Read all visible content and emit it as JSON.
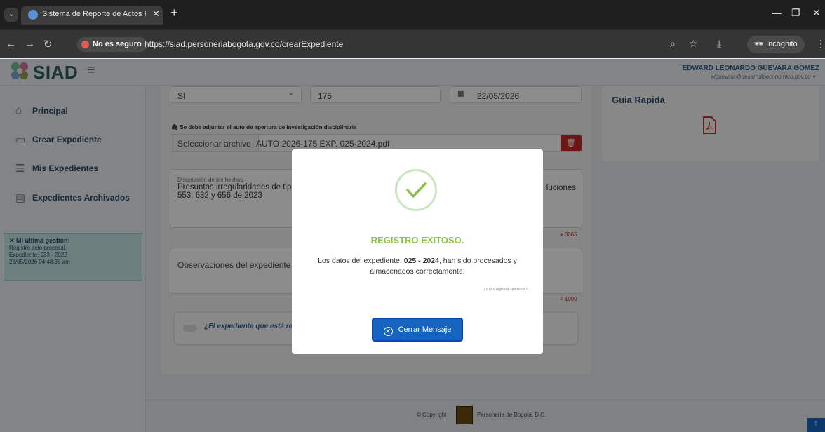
{
  "browser": {
    "tab_title": "Sistema de Reporte de Actos Pr",
    "insecure_label": "No es seguro",
    "url": "https://siad.personeriabogota.gov.co/crearExpediente",
    "incognito_label": "Incógnito"
  },
  "header": {
    "logo": "SIAD",
    "user_name": "EDWARD LEONARDO GUEVARA GOMEZ",
    "user_email": "elguevara@desarrolloeconomico.gov.co"
  },
  "sidebar": {
    "items": [
      {
        "label": "Principal",
        "icon": "home-icon"
      },
      {
        "label": "Crear Expediente",
        "icon": "folder-plus-icon"
      },
      {
        "label": "Mis Expedientes",
        "icon": "list-icon"
      },
      {
        "label": "Expedientes Archivados",
        "icon": "archive-icon"
      }
    ],
    "last_action": {
      "title": "Mi última gestión:",
      "line1": "Registro acto procesal.",
      "line2": "Expediente: 033 - 2022",
      "line3": "28/05/2026 04:48:35 am"
    }
  },
  "form": {
    "select_value": "SI",
    "number_value": "175",
    "date_value": "22/05/2026",
    "attach_label": "Se debe adjuntar el auto de apertura de investigación disciplinaria",
    "file_button": "Seleccionar archivo",
    "file_name": "AUTO 2026-175 EXP. 025-2024.pdf",
    "description_label": "Descripción de los hechos",
    "description_text": "Presuntas irregularidades de tip",
    "description_text_end": "luciones",
    "description_line2": "553, 632 y 656 de 2023",
    "description_count": "3865",
    "observations_placeholder": "Observaciones del expediente",
    "observations_count": "1000",
    "toggle_label": "¿El expediente que está reg"
  },
  "guide": {
    "title": "Guia Rapida"
  },
  "footer": {
    "copyright": "© Copyright",
    "org": "Personería de Bogotá, D.C."
  },
  "modal": {
    "title": "REGISTRO EXITOSO.",
    "message_pre": "Los datos del expediente: ",
    "message_id": "025 - 2024",
    "message_post": ", han sido procesados y almacenados correctamente.",
    "code": "( #13 // registroExpediente // )",
    "close_button": "Cerrar Mensaje"
  },
  "colors": {
    "brand": "#2f5f5f",
    "success": "#8bc34a",
    "primary": "#1565c0",
    "danger": "#c62828"
  }
}
